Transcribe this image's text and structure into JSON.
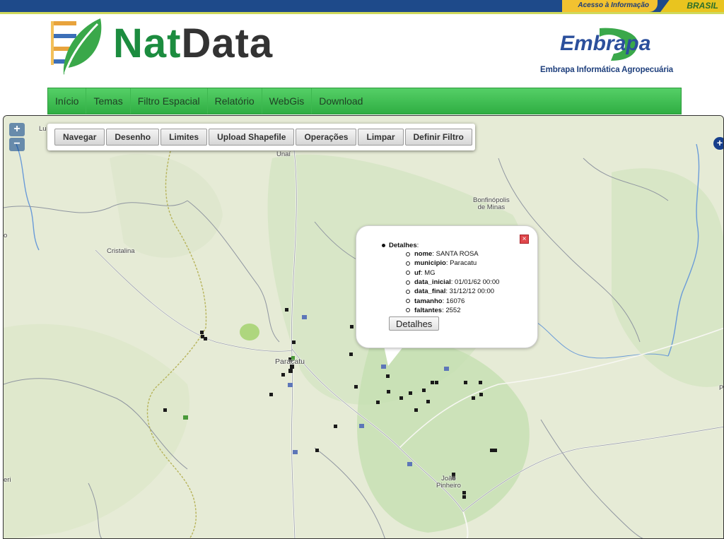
{
  "gov_bar": {
    "acesso": "Acesso à Informação",
    "brasil": "BRASIL"
  },
  "header": {
    "logo_nat": "Nat",
    "logo_data": "Data",
    "embrapa": "Embrapa",
    "embrapa_subtitle": "Embrapa Informática Agropecuária"
  },
  "nav": {
    "items": [
      {
        "label": "Início"
      },
      {
        "label": "Temas"
      },
      {
        "label": "Filtro Espacial"
      },
      {
        "label": "Relatório"
      },
      {
        "label": "WebGis"
      },
      {
        "label": "Download"
      }
    ]
  },
  "map": {
    "zoom_in": "+",
    "zoom_out": "−",
    "layer_switcher": "+",
    "toolbar": [
      {
        "label": "Navegar"
      },
      {
        "label": "Desenho"
      },
      {
        "label": "Limites"
      },
      {
        "label": "Upload Shapefile"
      },
      {
        "label": "Operações"
      },
      {
        "label": "Limpar"
      },
      {
        "label": "Definir Filtro"
      }
    ],
    "places": [
      {
        "name": "Unaí"
      },
      {
        "name": "Bonfinópolis\nde Minas"
      },
      {
        "name": "Cristalina"
      },
      {
        "name": "Paracatu"
      },
      {
        "name": "João\nPinheiro"
      },
      {
        "name": "Lu"
      },
      {
        "name": "eri"
      },
      {
        "name": "P"
      },
      {
        "name": "o"
      }
    ],
    "popup": {
      "close": "×",
      "title": "Detalhes",
      "title_suffix": ":",
      "fields": [
        {
          "key": "nome",
          "value": "SANTA ROSA"
        },
        {
          "key": "municipio",
          "value": "Paracatu"
        },
        {
          "key": "uf",
          "value": "MG"
        },
        {
          "key": "data_inicial",
          "value": "01/01/62 00:00"
        },
        {
          "key": "data_final",
          "value": "31/12/12 00:00"
        },
        {
          "key": "tamanho",
          "value": "16076"
        },
        {
          "key": "faltantes",
          "value": "2552"
        }
      ],
      "button": "Detalhes"
    },
    "colors": {
      "station": "#1a1a1a",
      "station_blue": "#5d76b8",
      "station_green": "#4a9a3a"
    }
  }
}
